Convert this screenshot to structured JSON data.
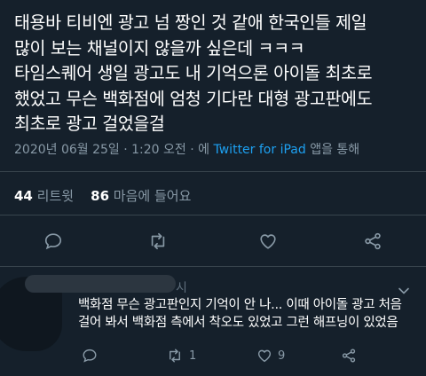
{
  "tweet": {
    "lines": [
      "태용바 티비엔 광고 넘 짱인 것 같애 한국인들 제일",
      "많이 보는 채널이지 않을까 싶은데 ㅋㅋㅋ",
      "타임스퀘어 생일 광고도 내 기억으론 아이돌 최초로",
      "했었고 무슨 백화점에 엄청 기다란 대형 광고판에도",
      "최초로 광고 걸었을걸"
    ],
    "timestamp": "2020년 06월 25일 · 1:20 오전 · ",
    "via_prefix": "에 ",
    "via_app": "Twitter for iPad",
    "via_suffix": " 앱을 통해"
  },
  "stats": {
    "retweets_count": "44",
    "retweets_label": "리트윗",
    "likes_count": "86",
    "likes_label": "마음에 들어요"
  },
  "actions": {
    "reply_icon": "reply-icon",
    "retweet_icon": "retweet-icon",
    "like_icon": "heart-icon",
    "share_icon": "share-icon"
  },
  "reply": {
    "header_tail": "시",
    "lines": [
      "백화점 무슨 광고판인지 기억이 안 나... 이때 아이돌 광고 처음",
      "걸어 봐서 백화점 측에서 착오도 있었고 그런 해프닝이 있었음"
    ],
    "retweet_count": "1",
    "like_count": "9"
  },
  "colors": {
    "background": "#15202b",
    "text": "#ffffff",
    "secondary": "#8899a6",
    "link": "#1da1f2",
    "divider": "#38444d"
  }
}
